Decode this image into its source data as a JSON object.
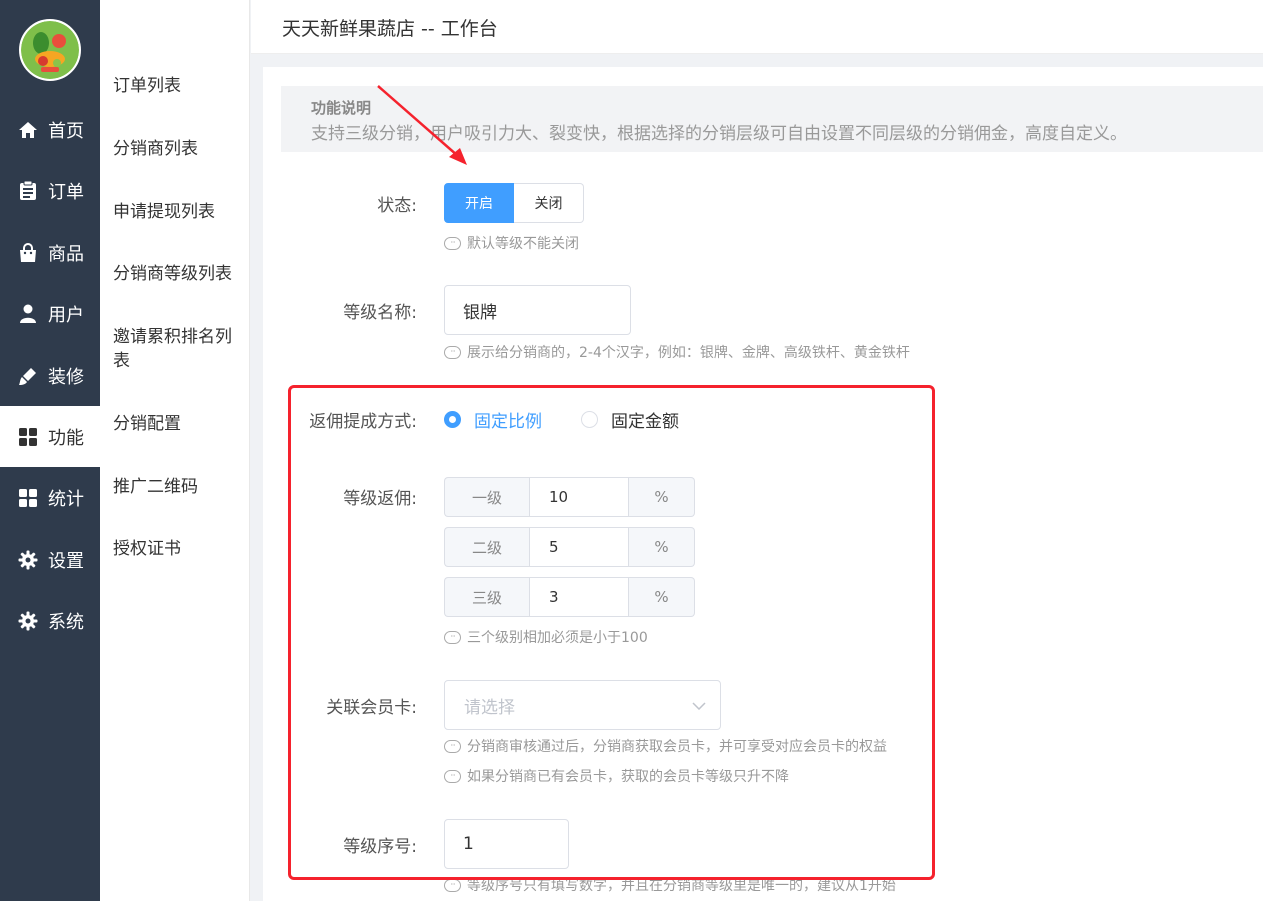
{
  "nav": {
    "items": [
      {
        "label": "首页",
        "icon": "home-icon"
      },
      {
        "label": "订单",
        "icon": "clipboard-icon"
      },
      {
        "label": "商品",
        "icon": "shopping-bag-icon"
      },
      {
        "label": "用户",
        "icon": "user-icon"
      },
      {
        "label": "装修",
        "icon": "brush-icon"
      },
      {
        "label": "功能",
        "icon": "grid-icon",
        "active": true
      },
      {
        "label": "统计",
        "icon": "grid-icon"
      },
      {
        "label": "设置",
        "icon": "gear-icon"
      },
      {
        "label": "系统",
        "icon": "gear-icon"
      }
    ]
  },
  "submenu": {
    "items": [
      "订单列表",
      "分销商列表",
      "申请提现列表",
      "分销商等级列表",
      "邀请累积排名列表",
      "分销配置",
      "推广二维码",
      "授权证书"
    ]
  },
  "header": {
    "title": "天天新鲜果蔬店 -- 工作台"
  },
  "info": {
    "title": "功能说明",
    "desc": "支持三级分销，用户吸引力大、裂变快，根据选择的分销层级可自由设置不同层级的分销佣金，高度自定义。"
  },
  "form": {
    "status": {
      "label": "状态:",
      "on": "开启",
      "off": "关闭",
      "hint": "默认等级不能关闭",
      "selected": "开启"
    },
    "level_name": {
      "label": "等级名称:",
      "value": "银牌",
      "hint": "展示给分销商的，2-4个汉字，例如：银牌、金牌、高级铁杆、黄金铁杆"
    },
    "commission_mode": {
      "label": "返佣提成方式:",
      "options": [
        "固定比例",
        "固定金额"
      ],
      "selected": "固定比例"
    },
    "rebate": {
      "label": "等级返佣:",
      "rows": [
        {
          "level": "一级",
          "value": "10",
          "unit": "%"
        },
        {
          "level": "二级",
          "value": "5",
          "unit": "%"
        },
        {
          "level": "三级",
          "value": "3",
          "unit": "%"
        }
      ],
      "hint": "三个级别相加必须是小于100"
    },
    "member_card": {
      "label": "关联会员卡:",
      "placeholder": "请选择",
      "hint1": "分销商审核通过后，分销商获取会员卡，并可享受对应会员卡的权益",
      "hint2": "如果分销商已有会员卡，获取的会员卡等级只升不降"
    },
    "order_no": {
      "label": "等级序号:",
      "value": "1",
      "hint": "等级序号只有填写数字，并且在分销商等级里是唯一的，建议从1开始"
    }
  },
  "colors": {
    "primary": "#409eff",
    "nav_bg": "#2f3b4c",
    "annotation": "#f5222d"
  }
}
